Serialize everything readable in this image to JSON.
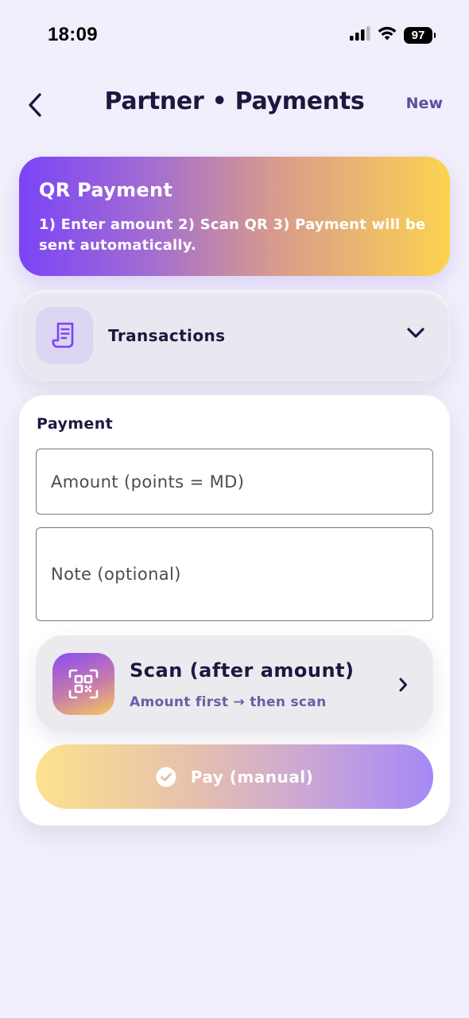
{
  "status_bar": {
    "time": "18:09",
    "battery": "97"
  },
  "header": {
    "title": "Partner • Payments",
    "new_label": "New"
  },
  "hero": {
    "title": "QR Payment",
    "text": "1) Enter amount  2) Scan QR  3) Payment will be sent automatically."
  },
  "transactions": {
    "label": "Transactions",
    "icon": "receipt-icon"
  },
  "payment": {
    "heading": "Payment",
    "amount_placeholder": "Amount (points = MD)",
    "amount_value": "",
    "note_placeholder": "Note (optional)",
    "note_value": "",
    "scan": {
      "title": "Scan (after amount)",
      "subtitle": "Amount first → then scan",
      "icon": "qr-code-icon"
    },
    "pay_button_label": "Pay (manual)"
  },
  "colors": {
    "background": "#f1effb",
    "text_primary": "#1d1840",
    "accent": "#5a4fa0",
    "purple": "#7a44f6",
    "yellow": "#fbd350"
  }
}
